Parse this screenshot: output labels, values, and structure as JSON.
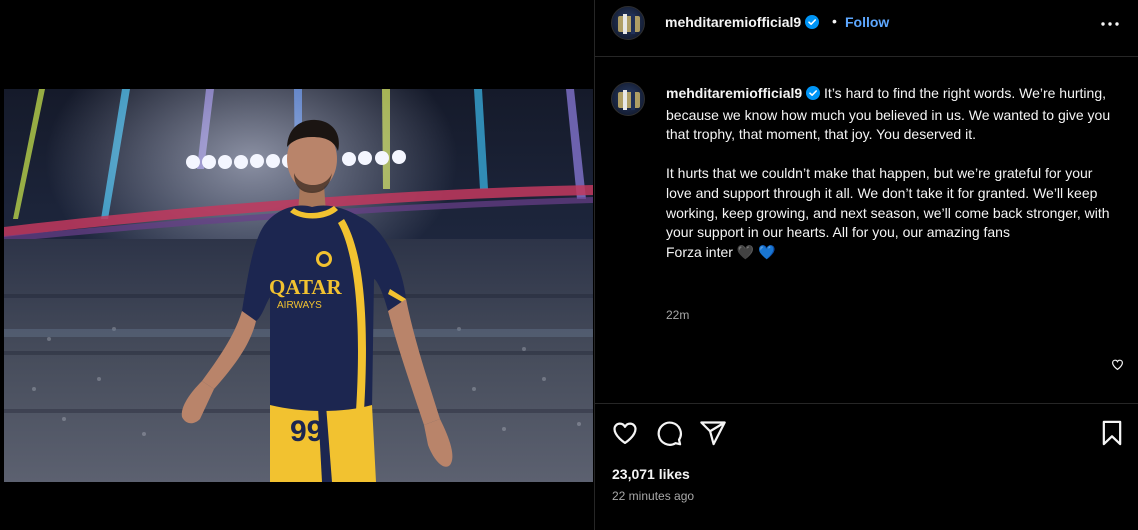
{
  "post": {
    "username": "mehditaremiofficial9",
    "separator": "•",
    "follow_label": "Follow",
    "caption_paragraph_1": "It’s hard to find the right words. We’re hurting, because we know how much you believed in us. We wanted to give you that trophy, that moment, that joy. You deserved it.",
    "caption_paragraph_2": "It hurts that we couldn’t make that happen, but we’re grateful for your love and support through it all. We don’t take it for granted. We’ll keep working, keep growing, and next season, we’ll come back stronger, with your support in our hearts. All for you, our amazing fans",
    "caption_paragraph_3": "Forza inter 🖤 💙",
    "caption_time": "22m",
    "likes_text": "23,071 likes",
    "posted_ago": "22 minutes ago"
  },
  "photo": {
    "shirt_sponsor_line1": "QATAR",
    "shirt_sponsor_line2": "AIRWAYS",
    "shirt_number": "99"
  },
  "icons": {
    "verified": "verified-badge-icon",
    "more": "more-options-icon",
    "like": "heart-icon",
    "comment": "comment-icon",
    "share": "share-icon",
    "save": "bookmark-icon",
    "comment_like": "small-heart-icon"
  },
  "colors": {
    "background": "#000000",
    "text": "#f5f5f5",
    "muted": "#a8a8a8",
    "follow": "#5ea8ff",
    "verified": "#0095f6",
    "divider": "#262626",
    "shirt": "#1c2650",
    "shirt_trim": "#f2c230"
  }
}
